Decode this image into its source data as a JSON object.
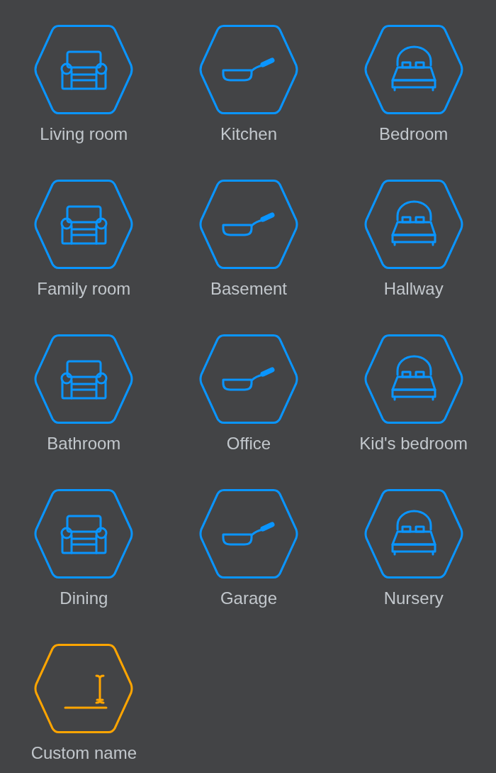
{
  "rooms": [
    {
      "label": "Living room",
      "kind": "armchair"
    },
    {
      "label": "Kitchen",
      "kind": "pan"
    },
    {
      "label": "Bedroom",
      "kind": "bed"
    },
    {
      "label": "Family room",
      "kind": "armchair"
    },
    {
      "label": "Basement",
      "kind": "pan"
    },
    {
      "label": "Hallway",
      "kind": "bed"
    },
    {
      "label": "Bathroom",
      "kind": "armchair"
    },
    {
      "label": "Office",
      "kind": "pan"
    },
    {
      "label": "Kid's bedroom",
      "kind": "bed"
    },
    {
      "label": "Dining",
      "kind": "armchair"
    },
    {
      "label": "Garage",
      "kind": "pan"
    },
    {
      "label": "Nursery",
      "kind": "bed"
    },
    {
      "label": "Custom name",
      "kind": "custom"
    }
  ]
}
